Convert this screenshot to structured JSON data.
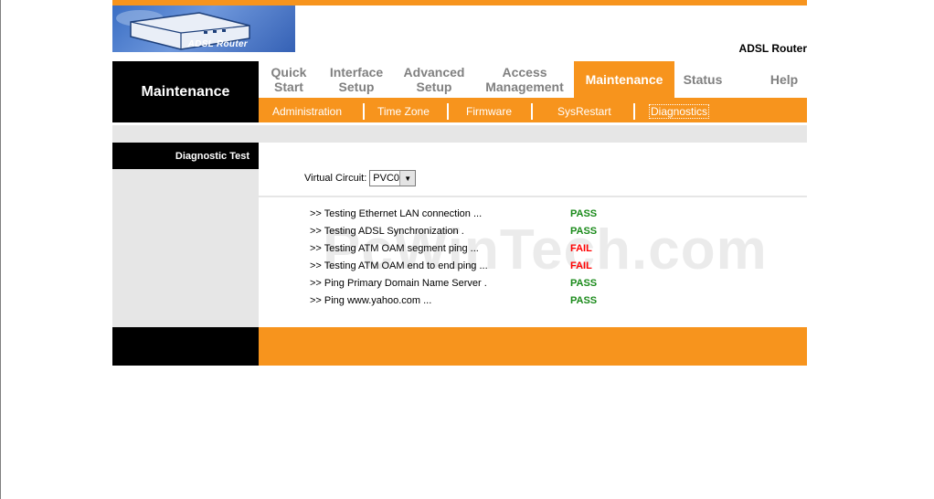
{
  "header": {
    "logo_text": "ADSL Router",
    "product_name": "ADSL Router"
  },
  "section_title": "Maintenance",
  "nav": {
    "tabs": [
      {
        "line1": "Quick",
        "line2": "Start"
      },
      {
        "line1": "Interface",
        "line2": "Setup"
      },
      {
        "line1": "Advanced",
        "line2": "Setup"
      },
      {
        "line1": "Access",
        "line2": "Management"
      },
      {
        "line1": "Maintenance",
        "line2": ""
      },
      {
        "line1": "Status",
        "line2": ""
      },
      {
        "line1": "Help",
        "line2": ""
      }
    ],
    "active_tab": "Maintenance"
  },
  "subnav": {
    "items": [
      "Administration",
      "Time Zone",
      "Firmware",
      "SysRestart",
      "Diagnostics"
    ],
    "selected": "Diagnostics"
  },
  "sidebar": {
    "heading": "Diagnostic Test"
  },
  "virtual_circuit": {
    "label": "Virtual Circuit:",
    "selected": "PVC0"
  },
  "results": [
    {
      "test": ">> Testing Ethernet LAN connection ...",
      "status": "PASS"
    },
    {
      "test": ">> Testing ADSL Synchronization .",
      "status": "PASS"
    },
    {
      "test": ">> Testing ATM OAM segment ping ...",
      "status": "FAIL"
    },
    {
      "test": ">> Testing ATM OAM end to end ping ...",
      "status": "FAIL"
    },
    {
      "test": ">> Ping Primary Domain Name Server .",
      "status": "PASS"
    },
    {
      "test": ">> Ping www.yahoo.com ...",
      "status": "PASS"
    }
  ],
  "watermark": "PcWinTech.com",
  "colors": {
    "accent": "#f7941d",
    "pass": "#1a8a1a",
    "fail": "#ff0000",
    "panel_grey": "#e6e6e6"
  }
}
